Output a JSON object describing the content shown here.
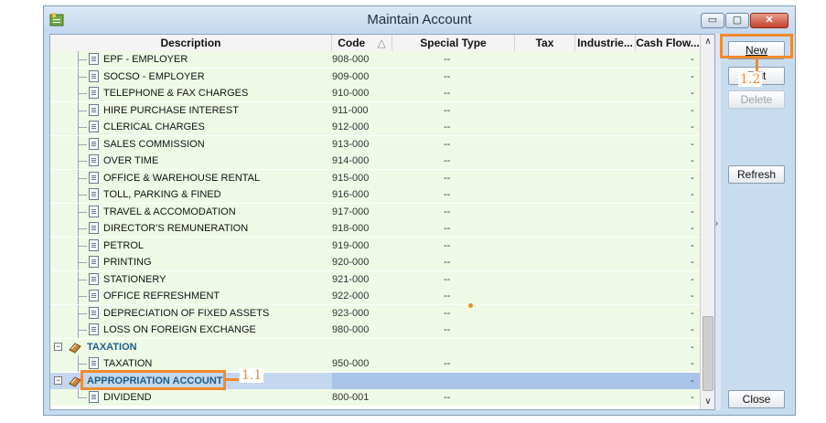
{
  "window": {
    "title": "Maintain Account",
    "controls": {
      "minimize": "▭",
      "maximize": "▢",
      "close": "✕"
    }
  },
  "grid": {
    "columns": [
      "Description",
      "Code",
      "Special Type",
      "Tax",
      "Industrie...",
      "Cash Flow..."
    ],
    "sort_indicator": "△",
    "rows": [
      {
        "type": "leaf",
        "desc": "EPF - EMPLOYER",
        "code": "908-000",
        "st": "--",
        "cf": "-"
      },
      {
        "type": "leaf",
        "desc": "SOCSO - EMPLOYER",
        "code": "909-000",
        "st": "--",
        "cf": "-"
      },
      {
        "type": "leaf",
        "desc": "TELEPHONE & FAX CHARGES",
        "code": "910-000",
        "st": "--",
        "cf": "-"
      },
      {
        "type": "leaf",
        "desc": "HIRE PURCHASE INTEREST",
        "code": "911-000",
        "st": "--",
        "cf": "-"
      },
      {
        "type": "leaf",
        "desc": "CLERICAL CHARGES",
        "code": "912-000",
        "st": "--",
        "cf": "-"
      },
      {
        "type": "leaf",
        "desc": "SALES COMMISSION",
        "code": "913-000",
        "st": "--",
        "cf": "-"
      },
      {
        "type": "leaf",
        "desc": "OVER TIME",
        "code": "914-000",
        "st": "--",
        "cf": "-"
      },
      {
        "type": "leaf",
        "desc": "OFFICE & WAREHOUSE RENTAL",
        "code": "915-000",
        "st": "--",
        "cf": "-"
      },
      {
        "type": "leaf",
        "desc": "TOLL, PARKING & FINED",
        "code": "916-000",
        "st": "--",
        "cf": "-"
      },
      {
        "type": "leaf",
        "desc": "TRAVEL & ACCOMODATION",
        "code": "917-000",
        "st": "--",
        "cf": "-"
      },
      {
        "type": "leaf",
        "desc": "DIRECTOR'S REMUNERATION",
        "code": "918-000",
        "st": "--",
        "cf": "-"
      },
      {
        "type": "leaf",
        "desc": "PETROL",
        "code": "919-000",
        "st": "--",
        "cf": "-"
      },
      {
        "type": "leaf",
        "desc": "PRINTING",
        "code": "920-000",
        "st": "--",
        "cf": "-"
      },
      {
        "type": "leaf",
        "desc": "STATIONERY",
        "code": "921-000",
        "st": "--",
        "cf": "-"
      },
      {
        "type": "leaf",
        "desc": "OFFICE REFRESHMENT",
        "code": "922-000",
        "st": "--",
        "cf": "-"
      },
      {
        "type": "leaf",
        "desc": "DEPRECIATION OF FIXED ASSETS",
        "code": "923-000",
        "st": "--",
        "cf": "-"
      },
      {
        "type": "leaf",
        "desc": "LOSS ON FOREIGN EXCHANGE",
        "code": "980-000",
        "st": "--",
        "cf": "-"
      },
      {
        "type": "group",
        "desc": "TAXATION",
        "code": "",
        "st": "",
        "cf": "-",
        "expander": "⊖"
      },
      {
        "type": "leaf",
        "desc": "TAXATION",
        "code": "950-000",
        "st": "--",
        "cf": "-"
      },
      {
        "type": "group",
        "desc": "APPROPRIATION ACCOUNT",
        "code": "",
        "st": "",
        "cf": "-",
        "expander": "⊖",
        "selected": true
      },
      {
        "type": "leaf",
        "desc": "DIVIDEND",
        "code": "800-001",
        "st": "--",
        "cf": "-"
      }
    ]
  },
  "panel": {
    "new": "New",
    "edit": "Edit",
    "delete": "Delete",
    "refresh": "Refresh",
    "close": "Close"
  },
  "annotations": {
    "step_1_1": "1.1",
    "step_1_2": "1.2",
    "color": "#f28a2c"
  },
  "scrollbar": {
    "up": "∧",
    "down": "∨",
    "splitter_arrow": "›"
  }
}
